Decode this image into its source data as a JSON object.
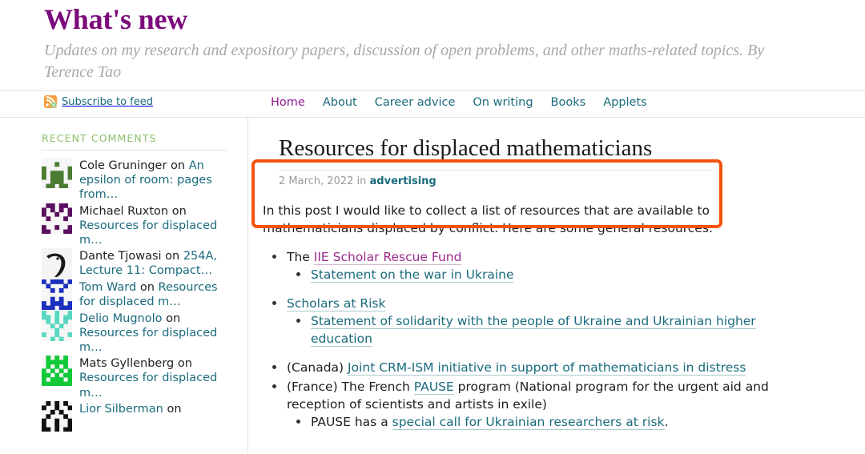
{
  "header": {
    "title": "What's new",
    "tagline": "Updates on my research and expository papers, discussion of open problems, and other maths-related topics. By Terence Tao",
    "subscribe_label": "Subscribe to feed",
    "subscribe_icon": "rss-feed-icon",
    "nav": [
      {
        "label": "Home",
        "current": true
      },
      {
        "label": "About",
        "current": false
      },
      {
        "label": "Career advice",
        "current": false
      },
      {
        "label": "On writing",
        "current": false
      },
      {
        "label": "Books",
        "current": false
      },
      {
        "label": "Applets",
        "current": false
      }
    ]
  },
  "sidebar": {
    "heading": "RECENT COMMENTS",
    "comments": [
      {
        "author": "Cole Gruninger",
        "author_is_link": false,
        "on": " on ",
        "post": "An epsilon of room: pages from…",
        "avatar": "identicon-green"
      },
      {
        "author": "Michael Ruxton",
        "author_is_link": false,
        "on": " on ",
        "post": "Resources for displaced m…",
        "avatar": "identicon-purple"
      },
      {
        "author": "Dante Tjowasi",
        "author_is_link": false,
        "on": " on ",
        "post": "254A, Lecture 11: Compact…",
        "avatar": "bird-avatar"
      },
      {
        "author": "Tom Ward",
        "author_is_link": true,
        "on": " on ",
        "post": "Resources for displaced m…",
        "avatar": "identicon-blue"
      },
      {
        "author": "Delio Mugnolo",
        "author_is_link": true,
        "on": " on ",
        "post": "Resources for displaced m…",
        "avatar": "identicon-teal"
      },
      {
        "author": "Mats Gyllenberg",
        "author_is_link": false,
        "on": " on ",
        "post": "Resources for displaced m…",
        "avatar": "identicon-brightgreen"
      },
      {
        "author": "Lior Silberman",
        "author_is_link": true,
        "on": " on ",
        "post": "",
        "avatar": "identicon-black"
      }
    ]
  },
  "post": {
    "title": "Resources for displaced mathematicians",
    "date": "2 March, 2022",
    "in_word": " in ",
    "category": "advertising",
    "intro": "In this post I would like to collect a list of resources that are available to mathematicians displaced by conflict. Here are some general resources:",
    "items": [
      {
        "prefix": "The ",
        "link": "IIE Scholar Rescue Fund",
        "link_visited": true,
        "suffix": "",
        "spaced": false,
        "children": [
          {
            "prefix": "",
            "link": "Statement on the war in Ukraine",
            "link_visited": false,
            "suffix": ""
          }
        ]
      },
      {
        "prefix": "",
        "link": "Scholars at Risk",
        "link_visited": false,
        "suffix": "",
        "spaced": true,
        "children": [
          {
            "prefix": "",
            "link": "Statement of solidarity with the people of Ukraine and Ukrainian higher education",
            "link_visited": false,
            "suffix": ""
          }
        ]
      },
      {
        "prefix": "(Canada) ",
        "link": "Joint CRM-ISM initiative in support of mathematicians in distress",
        "link_visited": false,
        "suffix": "",
        "spaced": true,
        "children": []
      },
      {
        "prefix": "(France) The French ",
        "link": "PAUSE",
        "link_visited": false,
        "suffix": " program (National program for the urgent aid and reception of scientists and artists in exile)",
        "spaced": false,
        "children": [
          {
            "prefix": "PAUSE has a ",
            "link": "special call for Ukrainian researchers at risk",
            "link_visited": false,
            "suffix": "."
          }
        ]
      }
    ]
  },
  "annotation": {
    "highlight_box_color": "#f5530d",
    "highlight_target": "post-header"
  },
  "colors": {
    "brand_purple": "#7b0a7b",
    "link_teal": "#1a6b7d",
    "visited_purple": "#9b2a8e",
    "sidebar_heading_green": "#8cc06a",
    "highlight_orange": "#f5530d"
  }
}
